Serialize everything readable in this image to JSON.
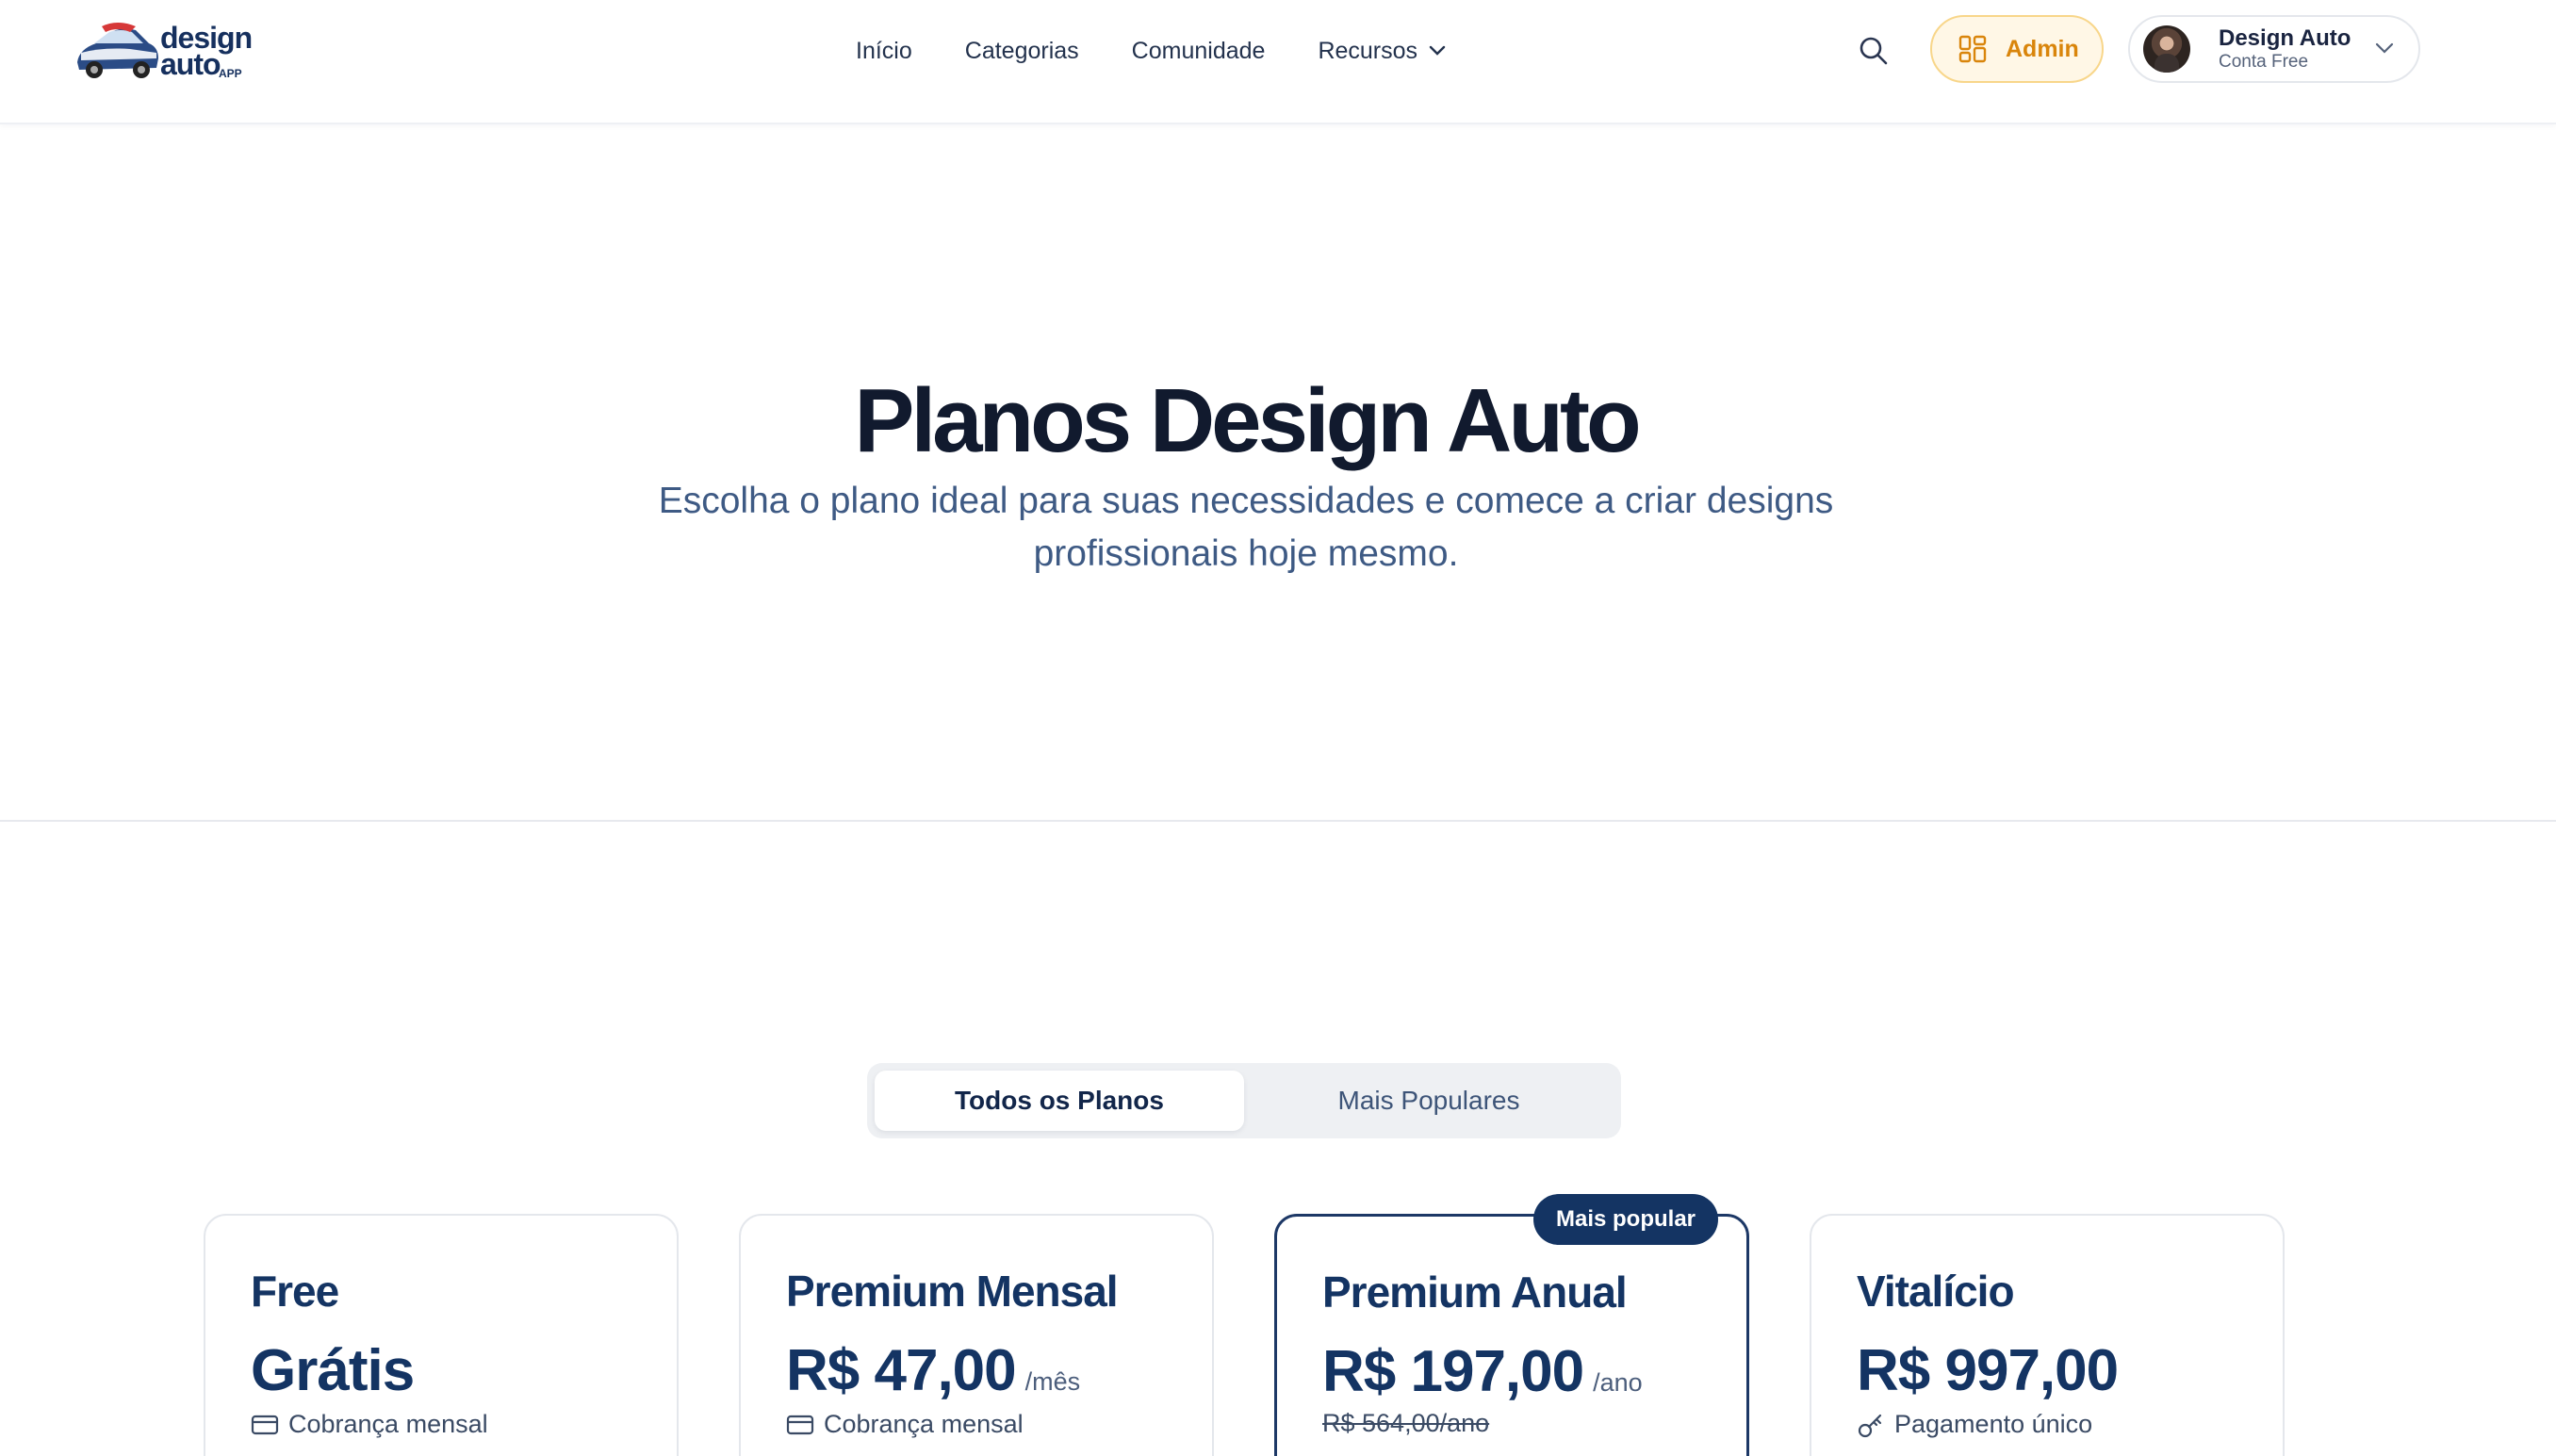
{
  "header": {
    "logo": {
      "line1": "design",
      "line2": "auto",
      "tag": "APP"
    },
    "nav": [
      {
        "label": "Início"
      },
      {
        "label": "Categorias"
      },
      {
        "label": "Comunidade"
      },
      {
        "label": "Recursos"
      }
    ],
    "admin_label": "Admin",
    "user": {
      "name": "Design Auto",
      "plan": "Conta Free"
    },
    "icons": [
      "search-icon",
      "grid-icon",
      "chevron-down-icon"
    ]
  },
  "hero": {
    "title": "Planos Design Auto",
    "subtitle": "Escolha o plano ideal para suas necessidades e comece a criar designs profissionais hoje mesmo."
  },
  "tabs": [
    {
      "label": "Todos os Planos",
      "active": true
    },
    {
      "label": "Mais Populares",
      "active": false
    }
  ],
  "plans": [
    {
      "name": "Free",
      "price": "Grátis",
      "period": "",
      "billing": "Cobrança mensal",
      "billing_icon": "card-icon"
    },
    {
      "name": "Premium Mensal",
      "price": "R$ 47,00",
      "period": "/mês",
      "billing": "Cobrança mensal",
      "billing_icon": "card-icon"
    },
    {
      "name": "Premium Anual",
      "price": "R$ 197,00",
      "period": "/ano",
      "old_price": "R$ 564,00/ano",
      "badge": "Mais popular"
    },
    {
      "name": "Vitalício",
      "price": "R$ 997,00",
      "period": "",
      "billing": "Pagamento único",
      "billing_icon": "key-icon"
    }
  ],
  "colors": {
    "brand_navy": "#143463",
    "admin_accent": "#d9850b",
    "admin_bg": "#fff7e6",
    "subtitle_blue": "#3e5a84"
  }
}
